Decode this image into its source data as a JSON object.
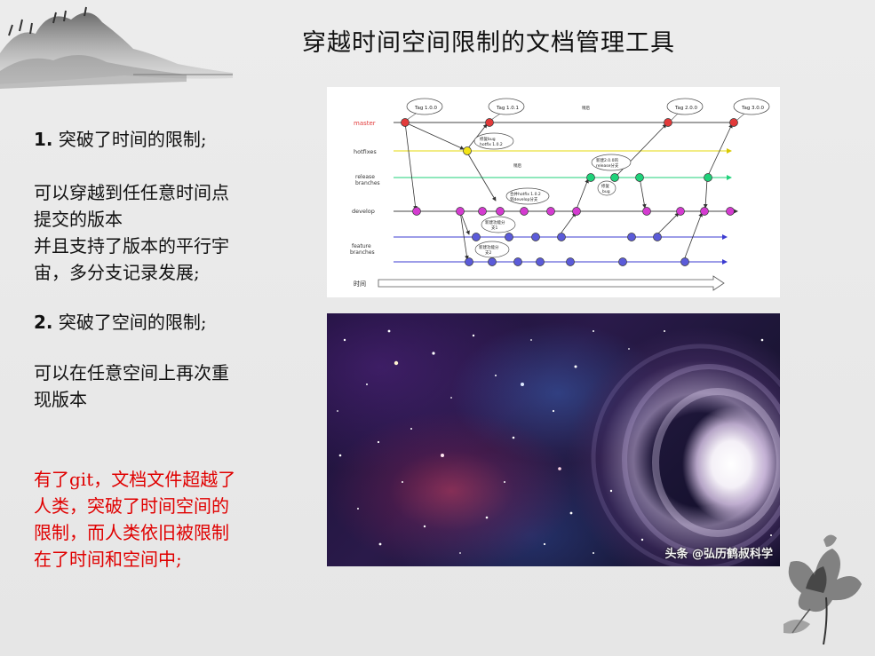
{
  "title": "穿越时间空间限制的文档管理工具",
  "left_text": {
    "point1_num": "1.",
    "point1_heading": " 突破了时间的限制;",
    "point1_body_lines": [
      "可以穿越到任任意时间点",
      "提交的版本",
      "并且支持了版本的平行宇",
      "宙，多分支记录发展;"
    ],
    "point2_num": "2.",
    "point2_heading": " 突破了空间的限制;",
    "point2_body_lines": [
      "可以在任意空间上再次重",
      "现版本"
    ],
    "red_note_lines": [
      "有了git，文档文件超越了",
      "人类，突破了时间空间的",
      "限制，而人类依旧被限制",
      "在了时间和空间中;"
    ]
  },
  "git_diagram": {
    "branches": [
      "master",
      "hotfixes",
      "release\nbranches",
      "develop",
      "feature\nbranches"
    ],
    "tags": [
      "Tag 1.0.0",
      "Tag 1.0.1",
      "Tag 2.0.0",
      "Tag 3.0.0"
    ],
    "notes": [
      "修复bug\nhotfix 1.0.2",
      "合并hotfix 1.0.2\n到develop分支",
      "新建2.0.0的\nrelease分支",
      "修复\nbug",
      "新建功能分\n支1",
      "新建功能分\n支2",
      "稍后",
      "稍后"
    ],
    "time_label": "时间",
    "colors": {
      "master": "#e23a3a",
      "hotfix": "#f3e415",
      "release": "#1fd27a",
      "develop": "#d43bd0",
      "feature": "#5b5bd9"
    }
  },
  "space_image": {
    "watermark": "头条 @弘历鹤叔科学"
  }
}
